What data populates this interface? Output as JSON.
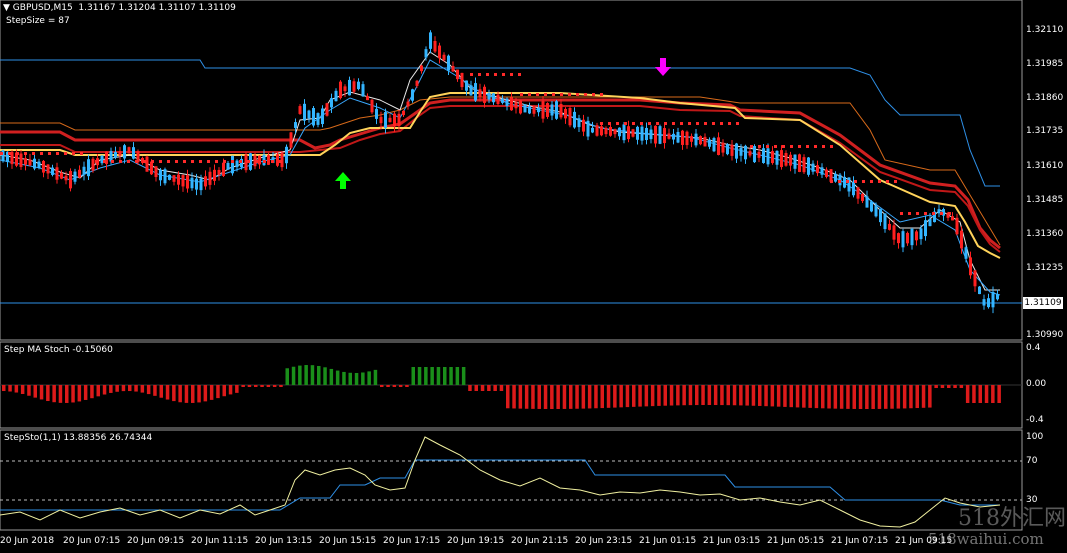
{
  "main_panel": {
    "symbol_label": "GBPUSD,M15",
    "ohlc": "1.31167 1.31204 1.31107 1.31109",
    "stepsize": "StepSize = 87",
    "current_price": "1.31109",
    "price_ticks": [
      "1.32110",
      "1.31985",
      "1.31860",
      "1.31735",
      "1.31610",
      "1.31485",
      "1.31360",
      "1.31235",
      "1.31109",
      "1.30990"
    ]
  },
  "stoch_ma_panel": {
    "title": "Step MA Stoch -0.15060",
    "ticks": [
      "0.4",
      "0.00",
      "-0.4"
    ]
  },
  "stepsto_panel": {
    "title": "StepSto(1,1) 13.88356 26.74344",
    "ticks": [
      "100",
      "70",
      "30"
    ]
  },
  "time_labels": [
    "20 Jun 2018",
    "20 Jun 07:15",
    "20 Jun 09:15",
    "20 Jun 11:15",
    "20 Jun 13:15",
    "20 Jun 15:15",
    "20 Jun 17:15",
    "20 Jun 19:15",
    "20 Jun 21:15",
    "20 Jun 23:15",
    "21 Jun 01:15",
    "21 Jun 03:15",
    "21 Jun 05:15",
    "21 Jun 07:15",
    "21 Jun 09:15"
  ],
  "watermark": "518外汇网",
  "watermark_url": "518waihui.com",
  "colors": {
    "bull_candle": "#33b5ff",
    "bear_candle": "#ff2020",
    "up_arrow": "#00ff00",
    "down_arrow": "#ff00ff",
    "hist_pos": "#1a8f1a",
    "hist_neg": "#dd1a1a"
  }
}
